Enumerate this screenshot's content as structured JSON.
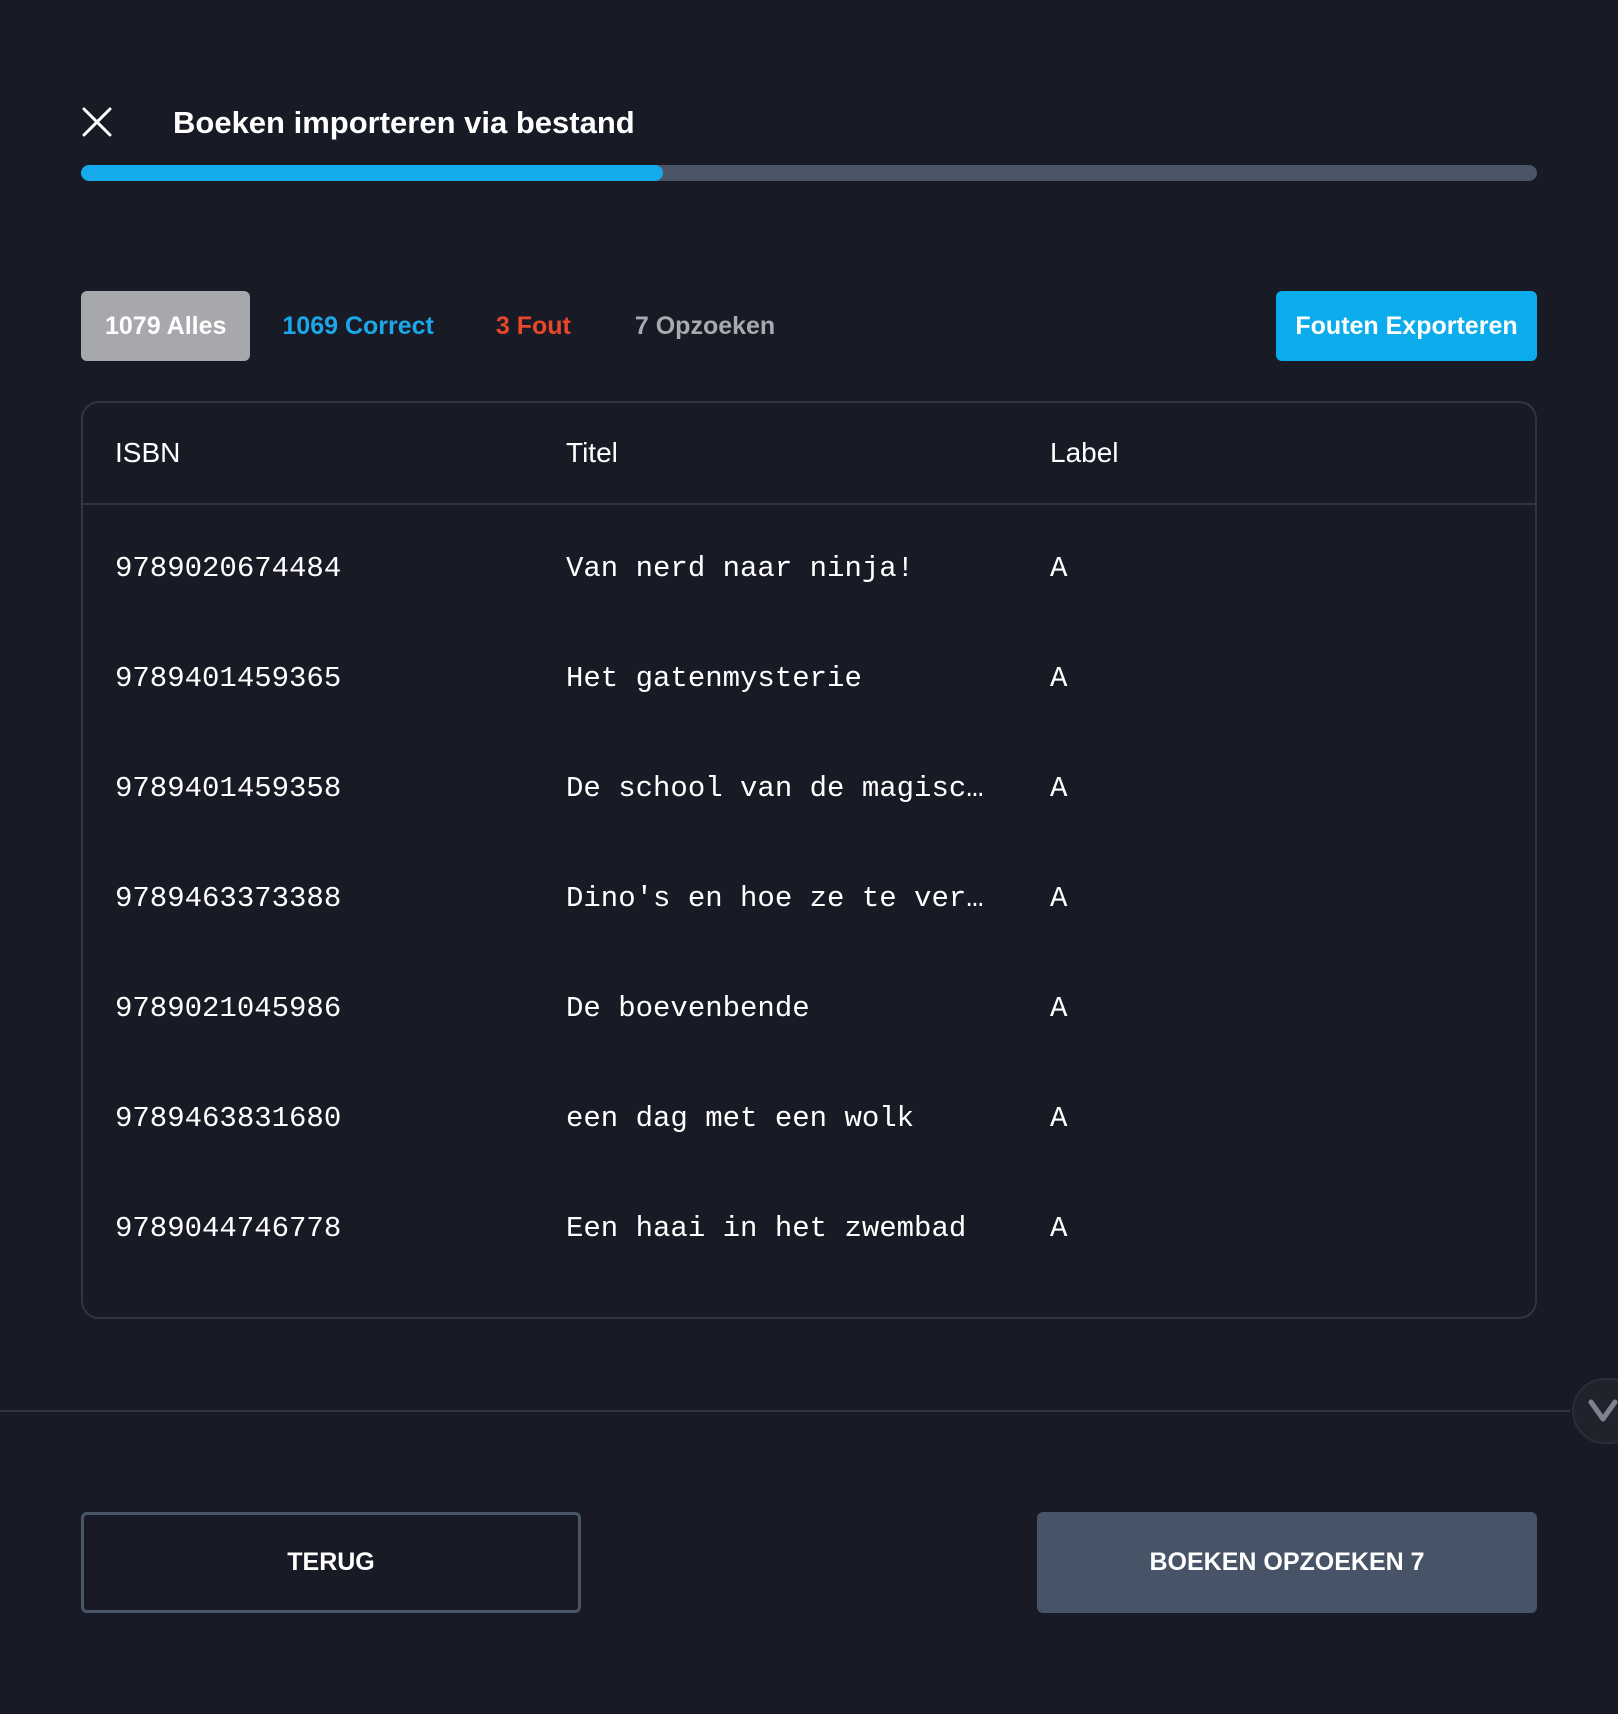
{
  "header": {
    "title": "Boeken importeren via bestand",
    "progress_fraction": 0.4
  },
  "tabs": [
    {
      "label": "1079 Alles",
      "active": true
    },
    {
      "label": "1069 Correct",
      "color": "#1aa8e8"
    },
    {
      "label": "3 Fout",
      "color": "#e9472a"
    },
    {
      "label": "7 Opzoeken",
      "color": "#a8aab0"
    }
  ],
  "export_label": "Fouten Exporteren",
  "table": {
    "columns": [
      "ISBN",
      "Titel",
      "Label"
    ],
    "rows": [
      {
        "isbn": "9789020674484",
        "titel": "Van nerd naar ninja!",
        "label": "A"
      },
      {
        "isbn": "9789401459365",
        "titel": "Het gatenmysterie",
        "label": "A"
      },
      {
        "isbn": "9789401459358",
        "titel": "De school van de magisc…",
        "label": "A"
      },
      {
        "isbn": "9789463373388",
        "titel": "Dino's en hoe ze te ver…",
        "label": "A"
      },
      {
        "isbn": "9789021045986",
        "titel": "De boevenbende",
        "label": "A"
      },
      {
        "isbn": "9789463831680",
        "titel": "een dag met een wolk",
        "label": "A"
      },
      {
        "isbn": "9789044746778",
        "titel": "Een haai in het zwembad",
        "label": "A"
      }
    ]
  },
  "footer": {
    "back_label": "TERUG",
    "lookup_label": "BOEKEN OPZOEKEN 7"
  },
  "colors": {
    "background": "#181a25",
    "accent": "#14aaeb",
    "error": "#e9472a",
    "track": "#4a5566"
  },
  "icons": {
    "close": "close-icon",
    "scroll": "chevron-down-icon"
  }
}
